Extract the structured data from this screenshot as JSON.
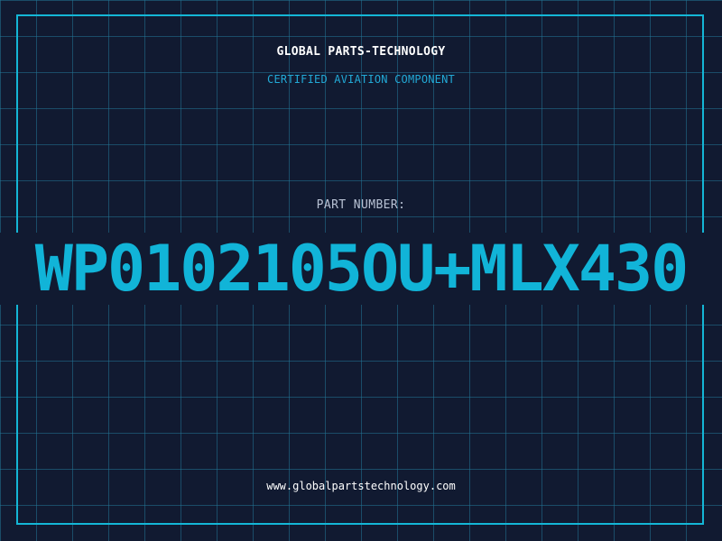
{
  "header": {
    "company": "GLOBAL PARTS-TECHNOLOGY",
    "subtitle": "CERTIFIED AVIATION COMPONENT"
  },
  "part": {
    "label": "PART NUMBER:",
    "number": "WP0102105OU+MLX430"
  },
  "footer": {
    "url": "www.globalpartstechnology.com"
  },
  "colors": {
    "background": "#111a31",
    "grid": "#227496",
    "accent": "#14b6d6",
    "text": "#ffffff"
  }
}
